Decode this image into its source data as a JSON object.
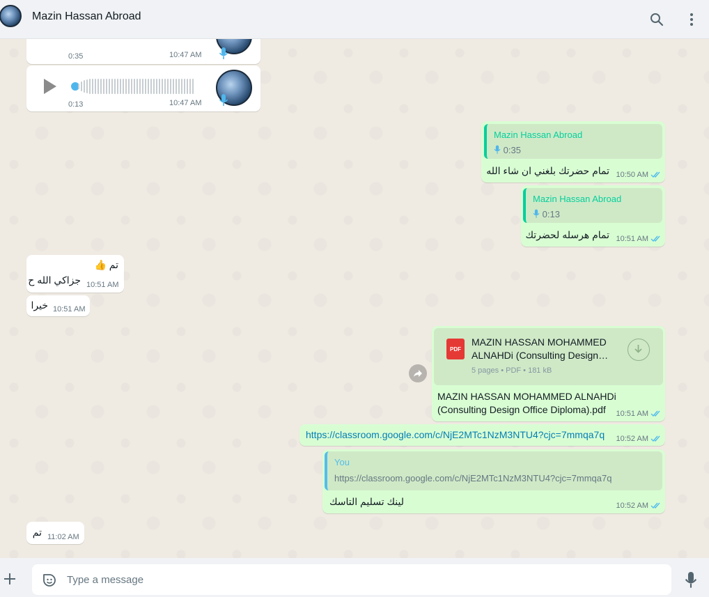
{
  "header": {
    "contact_name": "Mazin Hassan Abroad"
  },
  "messages": {
    "voice1": {
      "duration": "0:35",
      "time": "10:47 AM"
    },
    "voice2": {
      "duration": "0:13",
      "time": "10:47 AM"
    },
    "reply1": {
      "quoted_name": "Mazin Hassan Abroad",
      "quoted_duration": "0:35",
      "text": "تمام حضرتك بلغني ان شاء الله",
      "time": "10:50 AM"
    },
    "reply2": {
      "quoted_name": "Mazin Hassan Abroad",
      "quoted_duration": "0:13",
      "text": "تمام هرسله لحضرتك",
      "time": "10:51 AM"
    },
    "in1": {
      "line1": "تم 👍",
      "line2": "جزاكي الله ح",
      "time": "10:51 AM"
    },
    "in2": {
      "text": "خيرا",
      "time": "10:51 AM"
    },
    "doc": {
      "card_title_line1": "MAZIN HASSAN MOHAMMED",
      "card_title_line2": "ALNAHDi (Consulting Design…",
      "pdf_label": "PDF",
      "card_meta": "5 pages • PDF • 181 kB",
      "caption_line1": "MAZIN HASSAN MOHAMMED ALNAHDi",
      "caption_line2": "(Consulting Design Office Diploma).pdf",
      "time": "10:51 AM"
    },
    "link_msg": {
      "url": "https://classroom.google.com/c/NjE2MTc1NzM3NTU4?cjc=7mmqa7q",
      "time": "10:52 AM"
    },
    "reply3": {
      "quoted_name": "You",
      "quoted_text": "https://classroom.google.com/c/NjE2MTc1NzM3NTU4?cjc=7mmqa7q",
      "text": "لينك تسليم التاسك",
      "time": "10:52 AM"
    },
    "in3": {
      "text": "تم",
      "time": "11:02 AM"
    }
  },
  "composer": {
    "placeholder": "Type a message"
  },
  "colors": {
    "accent": "#06cf9c",
    "outgoing_bubble": "#d9fdd3",
    "incoming_bubble": "#ffffff",
    "link": "#027eb5",
    "read_ticks": "#53bdeb",
    "pdf_red": "#e53935"
  },
  "icons": [
    "search-icon",
    "menu-icon",
    "play-icon",
    "mic-icon",
    "double-check-icon",
    "pdf-icon",
    "download-icon",
    "forward-icon",
    "plus-icon",
    "sticker-icon"
  ]
}
